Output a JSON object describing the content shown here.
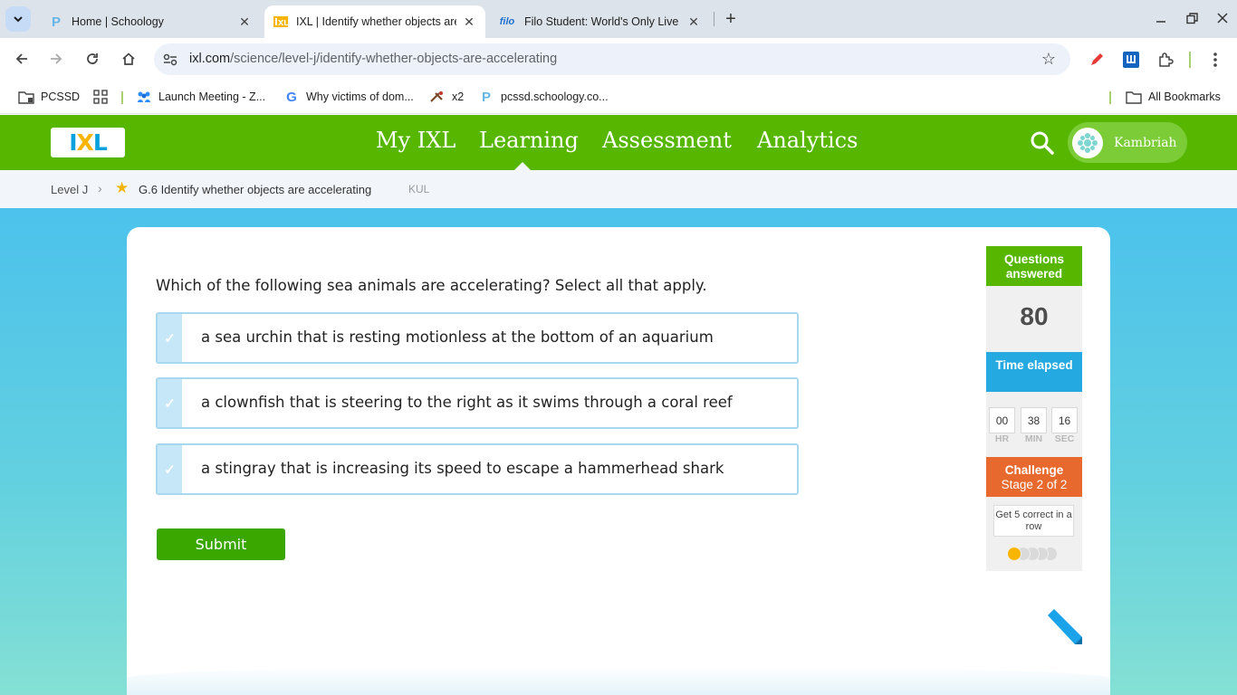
{
  "browser": {
    "tabs": [
      {
        "title": "Home | Schoology",
        "favicon": "schoology-icon",
        "active": false
      },
      {
        "title": "IXL | Identify whether objects are accelerating",
        "favicon": "ixl-icon",
        "active": true
      },
      {
        "title": "Filo Student: World's Only Live Instant Tutoring",
        "favicon": "filo-icon",
        "favicon_text": "filo",
        "active": false
      }
    ],
    "url_host": "ixl.com",
    "url_path": "/science/level-j/identify-whether-objects-are-accelerating",
    "bookmarks": [
      {
        "label": "PCSSD",
        "icon": "folder-icon"
      },
      {
        "label": "",
        "icon": "apps-grid-icon"
      },
      {
        "label": "Launch Meeting - Z...",
        "icon": "zoom-meeting-icon"
      },
      {
        "label": "Why victims of dom...",
        "icon": "google-icon"
      },
      {
        "label": "x2",
        "icon": "x2-icon"
      },
      {
        "label": "pcssd.schoology.co...",
        "icon": "schoology-icon"
      }
    ],
    "all_bookmarks_label": "All Bookmarks"
  },
  "ixl": {
    "logo": {
      "i": "I",
      "x": "X",
      "l": "L"
    },
    "nav": [
      "My IXL",
      "Learning",
      "Assessment",
      "Analytics"
    ],
    "active_nav": "Learning",
    "user_name": "Kambriah",
    "breadcrumb": {
      "level": "Level J",
      "skill": "G.6 Identify whether objects are accelerating",
      "code": "KUL"
    },
    "question": "Which of the following sea animals are accelerating? Select all that apply.",
    "options": [
      "a sea urchin that is resting motionless at the bottom of an aquarium",
      "a clownfish that is steering to the right as it swims through a coral reef",
      "a stingray that is increasing its speed to escape a hammerhead shark"
    ],
    "submit_label": "Submit",
    "sidebar": {
      "questions_answered_label": "Questions answered",
      "questions_answered": "80",
      "time_elapsed_label": "Time elapsed",
      "time": {
        "hr": "00",
        "min": "38",
        "sec": "16"
      },
      "time_units": {
        "hr": "HR",
        "min": "MIN",
        "sec": "SEC"
      },
      "challenge_label": "Challenge",
      "challenge_stage": "Stage 2 of 2",
      "challenge_goal": "Get 5 correct in a row",
      "progress_filled": 1,
      "progress_total": 5
    }
  },
  "colors": {
    "ixl_green": "#56b600",
    "ixl_blue": "#24a9e1",
    "challenge_orange": "#e8692e",
    "submit_green": "#3aa600",
    "progress_yellow": "#f7b500"
  }
}
